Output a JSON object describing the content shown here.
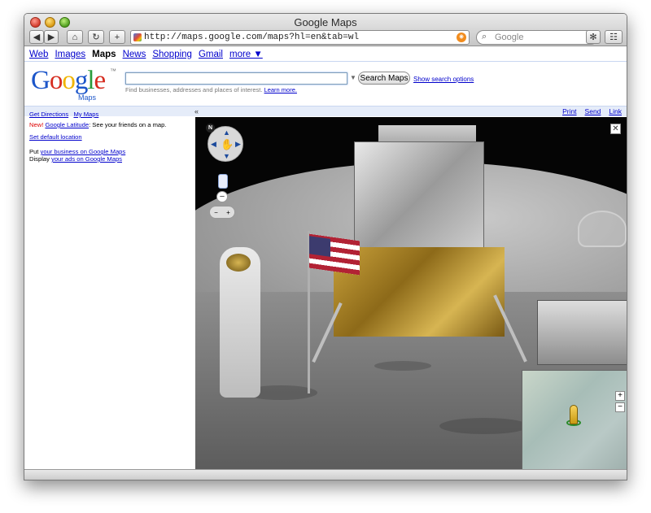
{
  "window": {
    "title": "Google Maps"
  },
  "toolbar": {
    "back_label": "◀",
    "forward_label": "▶",
    "home_label": "⌂",
    "reload_label": "↻",
    "add_label": "+",
    "url": "http://maps.google.com/maps?hl=en&tab=wl",
    "search_placeholder": "Google"
  },
  "gnav": {
    "items": [
      "Web",
      "Images",
      "Maps",
      "News",
      "Shopping",
      "Gmail",
      "more ▼"
    ],
    "active": "Maps"
  },
  "logo": {
    "letters": [
      "G",
      "o",
      "o",
      "g",
      "l",
      "e"
    ],
    "sub": "Maps"
  },
  "search": {
    "value": "",
    "button_label": "Search Maps",
    "options_label": "Show search options",
    "hint": "Find businesses, addresses and places of interest.",
    "learn_more": "Learn more."
  },
  "bluebar": {
    "collapse": "«",
    "print": "Print",
    "send": "Send",
    "link": "Link"
  },
  "sidebar": {
    "get_directions": "Get Directions",
    "my_maps": "My Maps",
    "new_badge": "New!",
    "latitude_link": "Google Latitude",
    "latitude_text": ": See your friends on a map.",
    "default_location": "Set default location",
    "put_prefix": "Put ",
    "business_link": "your business on Google Maps",
    "display_prefix": "Display ",
    "ads_link": "your ads on Google Maps"
  },
  "map": {
    "compass_label": "N",
    "close_label": "✕",
    "zoom_minus": "−",
    "zoom_out_label": "−",
    "zoom_in_label": "+",
    "minimap_plus": "+",
    "minimap_minus": "−"
  }
}
